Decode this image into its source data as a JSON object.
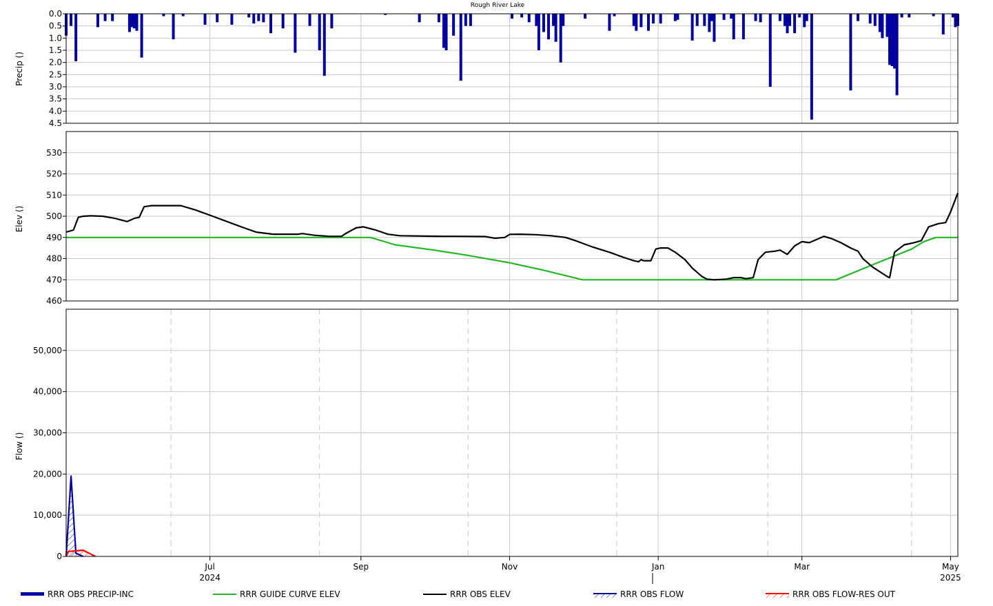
{
  "chart_data": {
    "type": "line",
    "title": "Rough River Lake",
    "x_range": [
      "2024-05-03",
      "2025-05-04"
    ],
    "x_ticks": [
      {
        "date": "2024-07-01",
        "label": "Jul",
        "sublabel": "2024"
      },
      {
        "date": "2024-09-01",
        "label": "Sep",
        "sublabel": ""
      },
      {
        "date": "2024-11-01",
        "label": "Nov",
        "sublabel": ""
      },
      {
        "date": "2025-01-01",
        "label": "Jan",
        "sublabel": ""
      },
      {
        "date": "2025-03-01",
        "label": "Mar",
        "sublabel": ""
      },
      {
        "date": "2025-05-01",
        "label": "May",
        "sublabel": "2025"
      }
    ],
    "panels": {
      "precip": {
        "ylabel": "Precip ()",
        "ylim": [
          0,
          4.5
        ],
        "inverted": true,
        "yticks": [
          {
            "v": 0,
            "label": "0.0"
          },
          {
            "v": 0.5,
            "label": "0.5"
          },
          {
            "v": 1.0,
            "label": "1.0"
          },
          {
            "v": 1.5,
            "label": "1.5"
          },
          {
            "v": 2.0,
            "label": "2.0"
          },
          {
            "v": 2.5,
            "label": "2.5"
          },
          {
            "v": 3.0,
            "label": "3.0"
          },
          {
            "v": 3.5,
            "label": "3.5"
          },
          {
            "v": 4.0,
            "label": "4.0"
          },
          {
            "v": 4.5,
            "label": "4.5"
          }
        ]
      },
      "elev": {
        "ylabel": "Elev ()",
        "ylim": [
          460,
          540
        ],
        "yticks": [
          {
            "v": 460,
            "label": "460"
          },
          {
            "v": 470,
            "label": "470"
          },
          {
            "v": 480,
            "label": "480"
          },
          {
            "v": 490,
            "label": "490"
          },
          {
            "v": 500,
            "label": "500"
          },
          {
            "v": 510,
            "label": "510"
          },
          {
            "v": 520,
            "label": "520"
          },
          {
            "v": 530,
            "label": "530"
          }
        ]
      },
      "flow": {
        "ylabel": "Flow ()",
        "ylim": [
          0,
          60000
        ],
        "yticks": [
          {
            "v": 0,
            "label": "0"
          },
          {
            "v": 10000,
            "label": "10,000"
          },
          {
            "v": 20000,
            "label": "20,000"
          },
          {
            "v": 30000,
            "label": "30,000"
          },
          {
            "v": 40000,
            "label": "40,000"
          },
          {
            "v": 50000,
            "label": "50,000"
          }
        ],
        "dashed_dates": [
          "2024-06-15",
          "2024-08-15",
          "2024-10-15",
          "2024-12-15",
          "2025-02-15",
          "2025-04-15"
        ]
      }
    },
    "series": [
      {
        "name": "RRR OBS PRECIP-INC",
        "color": "#0000a0",
        "panel": "precip",
        "style": "bar",
        "points": [
          [
            "2024-05-03",
            0.9
          ],
          [
            "2024-05-05",
            0.5
          ],
          [
            "2024-05-07",
            1.95
          ],
          [
            "2024-05-16",
            0.55
          ],
          [
            "2024-05-19",
            0.3
          ],
          [
            "2024-05-22",
            0.3
          ],
          [
            "2024-05-29",
            0.75
          ],
          [
            "2024-05-30",
            0.55
          ],
          [
            "2024-05-31",
            0.6
          ],
          [
            "2024-06-01",
            0.7
          ],
          [
            "2024-06-03",
            1.8
          ],
          [
            "2024-06-12",
            0.1
          ],
          [
            "2024-06-16",
            1.05
          ],
          [
            "2024-06-20",
            0.1
          ],
          [
            "2024-06-29",
            0.45
          ],
          [
            "2024-07-04",
            0.35
          ],
          [
            "2024-07-10",
            0.45
          ],
          [
            "2024-07-17",
            0.15
          ],
          [
            "2024-07-19",
            0.4
          ],
          [
            "2024-07-21",
            0.3
          ],
          [
            "2024-07-23",
            0.35
          ],
          [
            "2024-07-26",
            0.8
          ],
          [
            "2024-07-31",
            0.6
          ],
          [
            "2024-08-05",
            1.6
          ],
          [
            "2024-08-11",
            0.5
          ],
          [
            "2024-08-15",
            1.5
          ],
          [
            "2024-08-17",
            2.55
          ],
          [
            "2024-08-20",
            0.6
          ],
          [
            "2024-09-11",
            0.05
          ],
          [
            "2024-09-25",
            0.35
          ],
          [
            "2024-10-03",
            0.35
          ],
          [
            "2024-10-05",
            1.4
          ],
          [
            "2024-10-06",
            1.5
          ],
          [
            "2024-10-09",
            0.9
          ],
          [
            "2024-10-12",
            2.75
          ],
          [
            "2024-10-14",
            0.5
          ],
          [
            "2024-10-16",
            0.5
          ],
          [
            "2024-11-02",
            0.2
          ],
          [
            "2024-11-06",
            0.15
          ],
          [
            "2024-11-09",
            0.35
          ],
          [
            "2024-11-12",
            0.5
          ],
          [
            "2024-11-13",
            1.5
          ],
          [
            "2024-11-15",
            0.75
          ],
          [
            "2024-11-17",
            1.05
          ],
          [
            "2024-11-19",
            0.5
          ],
          [
            "2024-11-20",
            1.15
          ],
          [
            "2024-11-22",
            2.0
          ],
          [
            "2024-11-23",
            0.5
          ],
          [
            "2024-12-02",
            0.2
          ],
          [
            "2024-12-12",
            0.7
          ],
          [
            "2024-12-14",
            0.1
          ],
          [
            "2024-12-22",
            0.5
          ],
          [
            "2024-12-23",
            0.7
          ],
          [
            "2024-12-25",
            0.55
          ],
          [
            "2024-12-28",
            0.7
          ],
          [
            "2024-12-30",
            0.4
          ],
          [
            "2025-01-02",
            0.4
          ],
          [
            "2025-01-08",
            0.3
          ],
          [
            "2025-01-09",
            0.25
          ],
          [
            "2025-01-15",
            1.1
          ],
          [
            "2025-01-17",
            0.5
          ],
          [
            "2025-01-20",
            0.5
          ],
          [
            "2025-01-22",
            0.75
          ],
          [
            "2025-01-23",
            0.3
          ],
          [
            "2025-01-24",
            1.15
          ],
          [
            "2025-01-28",
            0.25
          ],
          [
            "2025-01-31",
            0.2
          ],
          [
            "2025-02-01",
            1.05
          ],
          [
            "2025-02-05",
            1.05
          ],
          [
            "2025-02-10",
            0.3
          ],
          [
            "2025-02-12",
            0.35
          ],
          [
            "2025-02-16",
            3.0
          ],
          [
            "2025-02-20",
            0.3
          ],
          [
            "2025-02-22",
            0.5
          ],
          [
            "2025-02-23",
            0.8
          ],
          [
            "2025-02-24",
            0.5
          ],
          [
            "2025-02-26",
            0.8
          ],
          [
            "2025-03-05",
            4.35
          ],
          [
            "2025-03-03",
            0.3
          ],
          [
            "2025-03-02",
            0.55
          ],
          [
            "2025-02-28",
            0.15
          ],
          [
            "2025-03-21",
            3.15
          ],
          [
            "2025-03-24",
            0.3
          ],
          [
            "2025-03-29",
            0.4
          ],
          [
            "2025-03-31",
            0.5
          ],
          [
            "2025-04-02",
            0.75
          ],
          [
            "2025-04-03",
            1.0
          ],
          [
            "2025-04-05",
            0.95
          ],
          [
            "2025-04-06",
            2.1
          ],
          [
            "2025-04-07",
            2.15
          ],
          [
            "2025-04-08",
            2.25
          ],
          [
            "2025-04-09",
            3.35
          ],
          [
            "2025-04-11",
            0.15
          ],
          [
            "2025-04-14",
            0.15
          ],
          [
            "2025-04-24",
            0.1
          ],
          [
            "2025-04-28",
            0.85
          ],
          [
            "2025-05-02",
            0.15
          ],
          [
            "2025-05-03",
            0.55
          ],
          [
            "2025-05-04",
            0.5
          ]
        ]
      },
      {
        "name": "RRR GUIDE CURVE ELEV",
        "color": "#22b822",
        "panel": "elev",
        "style": "line",
        "points": [
          [
            "2024-05-03",
            490
          ],
          [
            "2024-09-05",
            490
          ],
          [
            "2024-09-15",
            486.5
          ],
          [
            "2024-10-01",
            484
          ],
          [
            "2024-10-15",
            481.5
          ],
          [
            "2024-11-01",
            478
          ],
          [
            "2024-11-15",
            474.5
          ],
          [
            "2024-12-01",
            470
          ],
          [
            "2025-03-15",
            470
          ],
          [
            "2025-04-01",
            478
          ],
          [
            "2025-04-15",
            484.5
          ],
          [
            "2025-04-20",
            488
          ],
          [
            "2025-04-25",
            490
          ],
          [
            "2025-05-04",
            490
          ]
        ]
      },
      {
        "name": "RRR OBS ELEV",
        "color": "#000000",
        "panel": "elev",
        "style": "line",
        "points": [
          [
            "2024-05-03",
            492.5
          ],
          [
            "2024-05-06",
            493.5
          ],
          [
            "2024-05-08",
            499.5
          ],
          [
            "2024-05-10",
            500
          ],
          [
            "2024-05-13",
            500.2
          ],
          [
            "2024-05-18",
            500
          ],
          [
            "2024-05-23",
            499
          ],
          [
            "2024-05-28",
            497.5
          ],
          [
            "2024-05-31",
            499
          ],
          [
            "2024-06-02",
            499.5
          ],
          [
            "2024-06-04",
            504.5
          ],
          [
            "2024-06-07",
            505
          ],
          [
            "2024-06-12",
            505
          ],
          [
            "2024-06-16",
            505
          ],
          [
            "2024-06-19",
            505
          ],
          [
            "2024-06-25",
            503
          ],
          [
            "2024-07-01",
            500.5
          ],
          [
            "2024-07-08",
            497.5
          ],
          [
            "2024-07-15",
            494.5
          ],
          [
            "2024-07-20",
            492.5
          ],
          [
            "2024-07-27",
            491.5
          ],
          [
            "2024-08-06",
            491.5
          ],
          [
            "2024-08-08",
            491.8
          ],
          [
            "2024-08-13",
            491
          ],
          [
            "2024-08-19",
            490.5
          ],
          [
            "2024-08-24",
            490.5
          ],
          [
            "2024-08-26",
            492
          ],
          [
            "2024-08-30",
            494.5
          ],
          [
            "2024-09-02",
            495
          ],
          [
            "2024-09-07",
            493.5
          ],
          [
            "2024-09-12",
            491.5
          ],
          [
            "2024-09-17",
            490.8
          ],
          [
            "2024-09-27",
            490.6
          ],
          [
            "2024-10-05",
            490.5
          ],
          [
            "2024-10-11",
            490.5
          ],
          [
            "2024-10-22",
            490.4
          ],
          [
            "2024-10-26",
            489.6
          ],
          [
            "2024-10-30",
            490
          ],
          [
            "2024-11-01",
            491.4
          ],
          [
            "2024-11-05",
            491.5
          ],
          [
            "2024-11-12",
            491.3
          ],
          [
            "2024-11-18",
            490.8
          ],
          [
            "2024-11-24",
            490
          ],
          [
            "2024-11-28",
            488.5
          ],
          [
            "2024-12-05",
            485.5
          ],
          [
            "2024-12-12",
            483
          ],
          [
            "2024-12-18",
            480.5
          ],
          [
            "2024-12-22",
            479
          ],
          [
            "2024-12-24",
            478.5
          ],
          [
            "2024-12-25",
            479.5
          ],
          [
            "2024-12-26",
            479
          ],
          [
            "2024-12-29",
            479
          ],
          [
            "2024-12-31",
            484.5
          ],
          [
            "2025-01-02",
            485
          ],
          [
            "2025-01-05",
            485
          ],
          [
            "2025-01-08",
            483
          ],
          [
            "2025-01-12",
            479.5
          ],
          [
            "2025-01-15",
            475.5
          ],
          [
            "2025-01-19",
            471.5
          ],
          [
            "2025-01-21",
            470.3
          ],
          [
            "2025-01-24",
            470
          ],
          [
            "2025-01-29",
            470.3
          ],
          [
            "2025-02-01",
            471
          ],
          [
            "2025-02-04",
            471
          ],
          [
            "2025-02-06",
            470.5
          ],
          [
            "2025-02-09",
            471
          ],
          [
            "2025-02-11",
            479.5
          ],
          [
            "2025-02-14",
            483
          ],
          [
            "2025-02-18",
            483.5
          ],
          [
            "2025-02-20",
            484
          ],
          [
            "2025-02-23",
            482
          ],
          [
            "2025-02-26",
            486
          ],
          [
            "2025-03-01",
            488
          ],
          [
            "2025-03-04",
            487.5
          ],
          [
            "2025-03-06",
            488.5
          ],
          [
            "2025-03-10",
            490.5
          ],
          [
            "2025-03-13",
            489.5
          ],
          [
            "2025-03-17",
            487.5
          ],
          [
            "2025-03-21",
            485
          ],
          [
            "2025-03-24",
            483.5
          ],
          [
            "2025-03-26",
            480
          ],
          [
            "2025-03-30",
            476
          ],
          [
            "2025-04-03",
            473
          ],
          [
            "2025-04-05",
            471.5
          ],
          [
            "2025-04-06",
            471
          ],
          [
            "2025-04-08",
            483
          ],
          [
            "2025-04-12",
            486.5
          ],
          [
            "2025-04-16",
            487.5
          ],
          [
            "2025-04-19",
            488.5
          ],
          [
            "2025-04-22",
            495
          ],
          [
            "2025-04-26",
            496.5
          ],
          [
            "2025-04-29",
            497
          ],
          [
            "2025-05-01",
            502
          ],
          [
            "2025-05-04",
            511
          ]
        ]
      },
      {
        "name": "RRR OBS FLOW",
        "color": "#0000a0",
        "panel": "flow",
        "style": "hatched-line",
        "points": [
          [
            "2024-05-03",
            0
          ],
          [
            "2024-05-05",
            19500
          ],
          [
            "2024-05-07",
            800
          ],
          [
            "2024-05-10",
            0
          ]
        ]
      },
      {
        "name": "RRR OBS FLOW-RES OUT",
        "color": "#ff0000",
        "panel": "flow",
        "style": "hatched-line",
        "points": [
          [
            "2024-05-03",
            0
          ],
          [
            "2024-05-04",
            1200
          ],
          [
            "2024-05-10",
            1500
          ],
          [
            "2024-05-15",
            0
          ]
        ]
      }
    ],
    "legend": {
      "placement": "bottom"
    }
  }
}
